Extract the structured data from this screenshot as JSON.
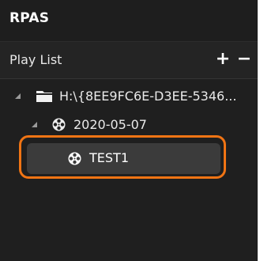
{
  "app": {
    "title": "RPAS"
  },
  "playlist": {
    "label": "Play List",
    "add_label": "+",
    "remove_label": "−"
  },
  "tree": {
    "root": {
      "label": "H:\\{8EE9FC6E-D3EE-5346...",
      "icon": "folder-icon",
      "expanded": true
    },
    "date_node": {
      "label": "2020-05-07",
      "icon": "film-reel-icon",
      "expanded": true
    },
    "items": [
      {
        "label": "TEST1",
        "icon": "film-reel-icon",
        "selected": true
      }
    ]
  },
  "colors": {
    "panel_bg": "#1f1f1f",
    "selection_bg": "#3b3b3b",
    "highlight_ring": "#f07414",
    "text": "#eaeaea"
  }
}
